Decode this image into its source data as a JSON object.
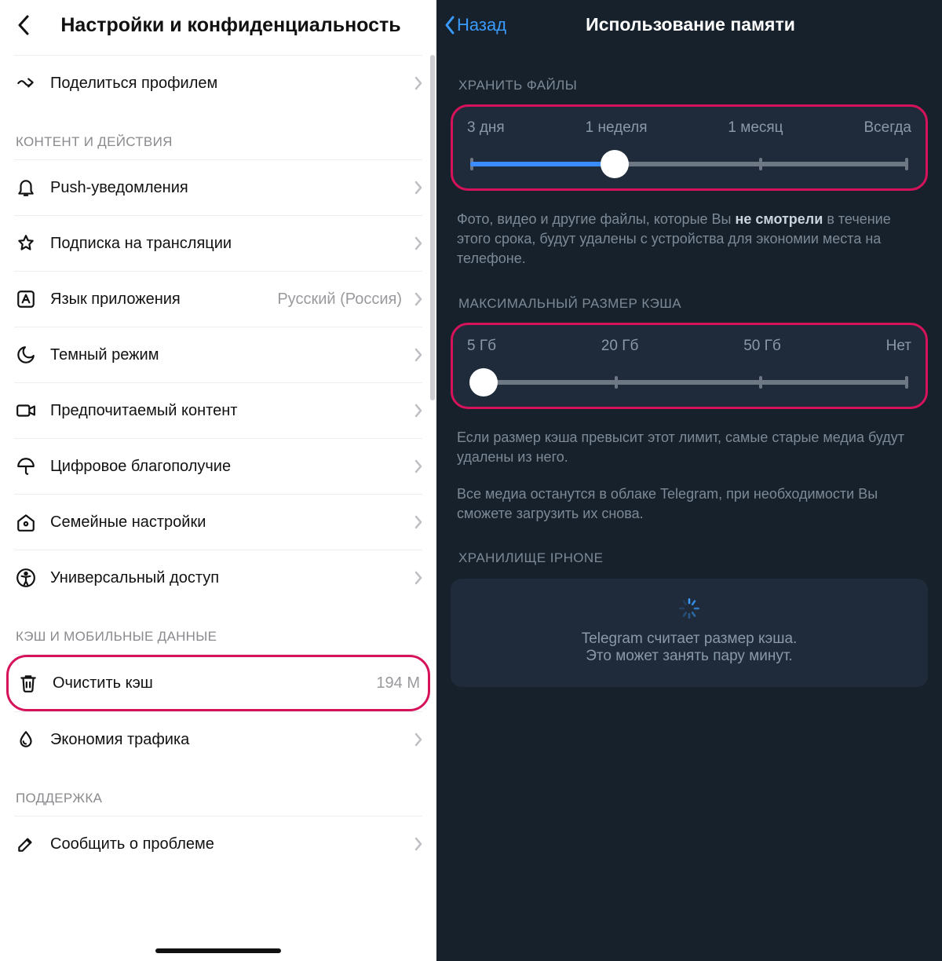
{
  "colors": {
    "highlight": "#d6135a",
    "accent_blue": "#3a9bff"
  },
  "left": {
    "title": "Настройки и конфиденциальность",
    "share_row": {
      "label": "Поделиться профилем"
    },
    "section_content": "КОНТЕНТ И ДЕЙСТВИЯ",
    "rows_content": [
      {
        "icon": "bell",
        "label": "Push-уведомления"
      },
      {
        "icon": "star",
        "label": "Подписка на трансляции"
      },
      {
        "icon": "language",
        "label": "Язык приложения",
        "value": "Русский (Россия)"
      },
      {
        "icon": "moon",
        "label": "Темный режим"
      },
      {
        "icon": "camera",
        "label": "Предпочитаемый контент"
      },
      {
        "icon": "umbrella",
        "label": "Цифровое благополучие"
      },
      {
        "icon": "home",
        "label": "Семейные настройки"
      },
      {
        "icon": "accessibility",
        "label": "Универсальный доступ"
      }
    ],
    "section_cache": "КЭШ И МОБИЛЬНЫЕ ДАННЫЕ",
    "row_clear_cache": {
      "label": "Очистить кэш",
      "value": "194 M"
    },
    "row_data_save": {
      "label": "Экономия трафика"
    },
    "section_support": "ПОДДЕРЖКА",
    "row_report": {
      "label": "Сообщить о проблеме"
    }
  },
  "right": {
    "back_label": "Назад",
    "title": "Использование памяти",
    "keep_files": {
      "header": "ХРАНИТЬ ФАЙЛЫ",
      "labels": [
        "3 дня",
        "1 неделя",
        "1 месяц",
        "Всегда"
      ],
      "selected_index": 1,
      "description_prefix": "Фото, видео и другие файлы, которые Вы ",
      "description_bold": "не смотрели",
      "description_suffix": " в течение этого срока, будут удалены с устройства для экономии места на телефоне."
    },
    "max_cache": {
      "header": "МАКСИМАЛЬНЫЙ РАЗМЕР КЭША",
      "labels": [
        "5 Гб",
        "20 Гб",
        "50 Гб",
        "Нет"
      ],
      "selected_index": 0,
      "desc1": "Если размер кэша превысит этот лимит, самые старые медиа будут удалены из него.",
      "desc2": "Все медиа останутся в облаке Telegram, при необходимости Вы сможете загрузить их снова."
    },
    "storage": {
      "header": "ХРАНИЛИЩЕ IPHONE",
      "line1": "Telegram считает размер кэша.",
      "line2": "Это может занять пару минут."
    }
  }
}
